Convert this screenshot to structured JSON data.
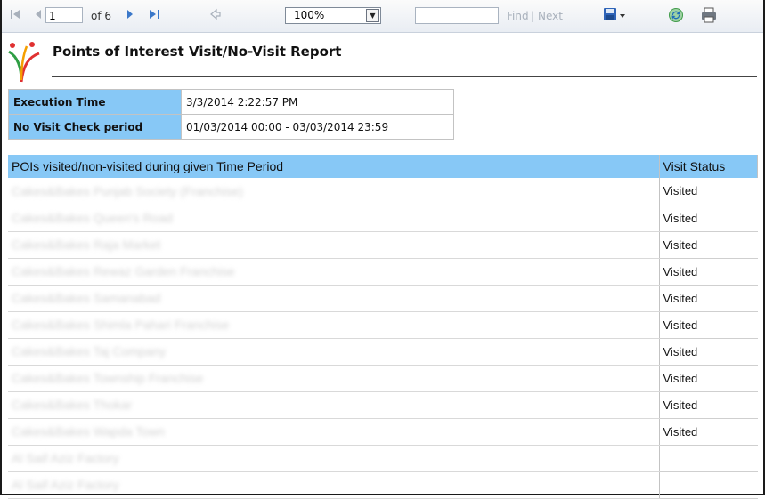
{
  "toolbar": {
    "page_current": "1",
    "page_of": "of 6",
    "zoom_value": "100%",
    "find_label": "Find",
    "separator": "|",
    "next_label": "Next"
  },
  "report": {
    "title": "Points of Interest Visit/No-Visit Report",
    "info": [
      {
        "label": "Execution Time",
        "value": "3/3/2014 2:22:57 PM"
      },
      {
        "label": "No Visit Check period",
        "value": "01/03/2014 00:00 - 03/03/2014 23:59"
      }
    ],
    "columns": [
      "POIs visited/non-visited during given Time Period",
      "Visit Status"
    ],
    "rows": [
      {
        "name": "Cakes&Bakes Punjab Society (Franchise)",
        "status": "Visited"
      },
      {
        "name": "Cakes&Bakes Queen's Road",
        "status": "Visited"
      },
      {
        "name": "Cakes&Bakes Raja Market",
        "status": "Visited"
      },
      {
        "name": "Cakes&Bakes Rewaz Garden Franchise",
        "status": "Visited"
      },
      {
        "name": "Cakes&Bakes Samanabad",
        "status": "Visited"
      },
      {
        "name": "Cakes&Bakes Shimla Pahari Franchise",
        "status": "Visited"
      },
      {
        "name": "Cakes&Bakes Taj Company",
        "status": "Visited"
      },
      {
        "name": "Cakes&Bakes Township Franchise",
        "status": "Visited"
      },
      {
        "name": "Cakes&Bakes Thokar",
        "status": "Visited"
      },
      {
        "name": "Cakes&Bakes Wapda Town",
        "status": "Visited"
      },
      {
        "name": "Al Saif Aziz Factory",
        "status": ""
      },
      {
        "name": "Al Saif Aziz Factory",
        "status": ""
      }
    ]
  }
}
